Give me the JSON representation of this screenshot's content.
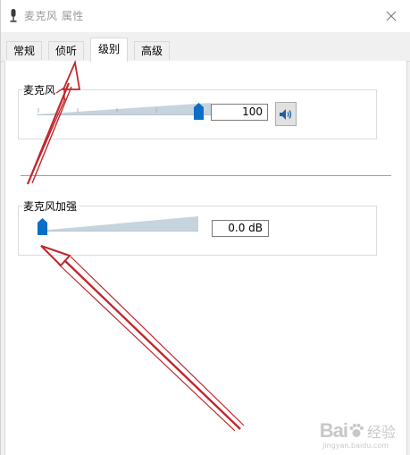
{
  "window": {
    "title": "麦克风 属性",
    "close_glyph": "✕"
  },
  "tabs": [
    {
      "label": "常规",
      "active": false
    },
    {
      "label": "侦听",
      "active": false
    },
    {
      "label": "级别",
      "active": true
    },
    {
      "label": "高级",
      "active": false
    }
  ],
  "microphone": {
    "label": "麦克风",
    "level": 100,
    "value_text": "100",
    "speaker_icon": "speaker-icon"
  },
  "boost": {
    "label": "麦克风加强",
    "level": 0,
    "value_text": "0.0 dB"
  },
  "watermark": {
    "brand": "Bai",
    "brand_suffix": "经验",
    "url": "jingyan.baidu.com"
  },
  "colors": {
    "thumb": "#0a6fc5",
    "arrow": "#c0272d",
    "track": "#c6d4dd"
  }
}
